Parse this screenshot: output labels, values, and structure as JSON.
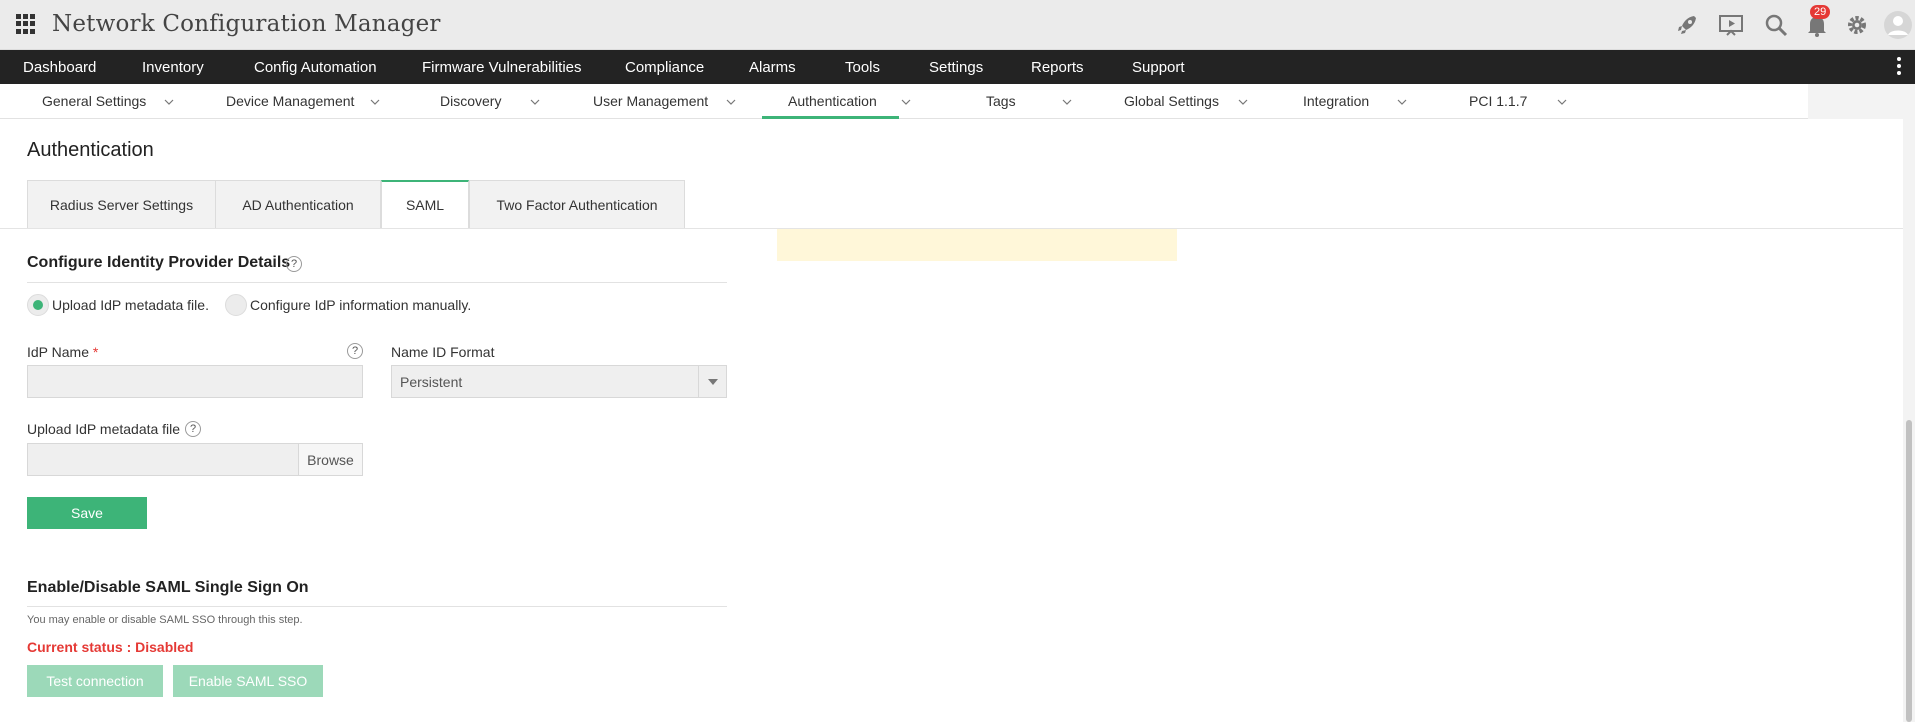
{
  "app": {
    "title": "Network Configuration Manager",
    "notification_count": "29"
  },
  "header_icons": [
    "rocket-icon",
    "presentation-icon",
    "search-icon",
    "bell-icon",
    "gear-icon",
    "user-avatar-icon"
  ],
  "main_nav": [
    "Dashboard",
    "Inventory",
    "Config Automation",
    "Firmware Vulnerabilities",
    "Compliance",
    "Alarms",
    "Tools",
    "Settings",
    "Reports",
    "Support"
  ],
  "sub_nav": [
    "General Settings",
    "Device Management",
    "Discovery",
    "User Management",
    "Authentication",
    "Tags",
    "Global Settings",
    "Integration",
    "PCI 1.1.7"
  ],
  "sub_nav_active": "Authentication",
  "page": {
    "title": "Authentication"
  },
  "tabs": [
    "Radius Server Settings",
    "AD Authentication",
    "SAML",
    "Two Factor Authentication"
  ],
  "tabs_active": "SAML",
  "idp": {
    "section_title": "Configure Identity Provider Details",
    "help": "?",
    "radio_upload": "Upload IdP metadata file.",
    "radio_manual": "Configure IdP information manually.",
    "idp_name_label": "IdP Name",
    "required_mark": "*",
    "idp_name_value": "",
    "name_id_format_label": "Name ID Format",
    "name_id_format_value": "Persistent",
    "upload_label": "Upload IdP metadata file",
    "upload_value": "",
    "browse_label": "Browse",
    "save_label": "Save"
  },
  "sso": {
    "section_title": "Enable/Disable SAML Single Sign On",
    "description": "You may enable or disable SAML SSO through this step.",
    "status": "Current status : Disabled",
    "test_label": "Test connection",
    "enable_label": "Enable SAML SSO"
  },
  "colors": {
    "accent": "#3db478",
    "nav_bg": "#232323",
    "error": "#e53935",
    "highlight": "#fff7d9"
  }
}
